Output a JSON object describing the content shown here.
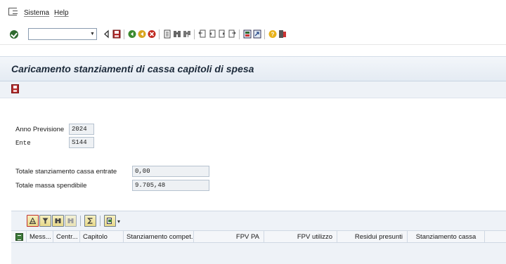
{
  "menu": {
    "items": [
      {
        "label": "Sistema"
      },
      {
        "label": "Help"
      }
    ]
  },
  "toolbar": {
    "command_field_value": "",
    "icons": [
      "enter-icon",
      "back-icon",
      "save-icon",
      "back-green-icon",
      "exit-icon",
      "cancel-icon",
      "print-icon",
      "find-icon",
      "find-next-icon",
      "first-page-icon",
      "previous-page-icon",
      "next-page-icon",
      "last-page-icon",
      "new-session-icon",
      "shortcut-icon",
      "help-icon",
      "customize-layout-icon"
    ]
  },
  "title": {
    "text": "Caricamento stanziamenti di cassa capitoli di spesa"
  },
  "fields": {
    "anno_previsione": {
      "label": "Anno Previsione",
      "value": "2024"
    },
    "ente": {
      "label": "Ente",
      "value": "S144"
    },
    "totale_cassa_entrate": {
      "label": "Totale stanziamento cassa entrate",
      "value": "0,00"
    },
    "totale_massa_spendibile": {
      "label": "Totale massa spendibile",
      "value": "9.705,48"
    }
  },
  "alv": {
    "toolbar_buttons": [
      "sort-ascending-icon",
      "filter-icon",
      "find-icon",
      "find-next-icon",
      "sum-icon",
      "export-icon"
    ],
    "columns": [
      {
        "label": "Mess..."
      },
      {
        "label": "Centr..."
      },
      {
        "label": "Capitolo"
      },
      {
        "label": "Stanziamento compet..."
      },
      {
        "label": "FPV PA"
      },
      {
        "label": "FPV utilizzo"
      },
      {
        "label": "Residui presunti"
      },
      {
        "label": "Stanziamento cassa"
      }
    ]
  },
  "colors": {
    "title_bar": "#e4ebf3",
    "save_red": "#b22a2a",
    "enter_green": "#2e6b2e",
    "alv_button": "#e8d98a"
  }
}
